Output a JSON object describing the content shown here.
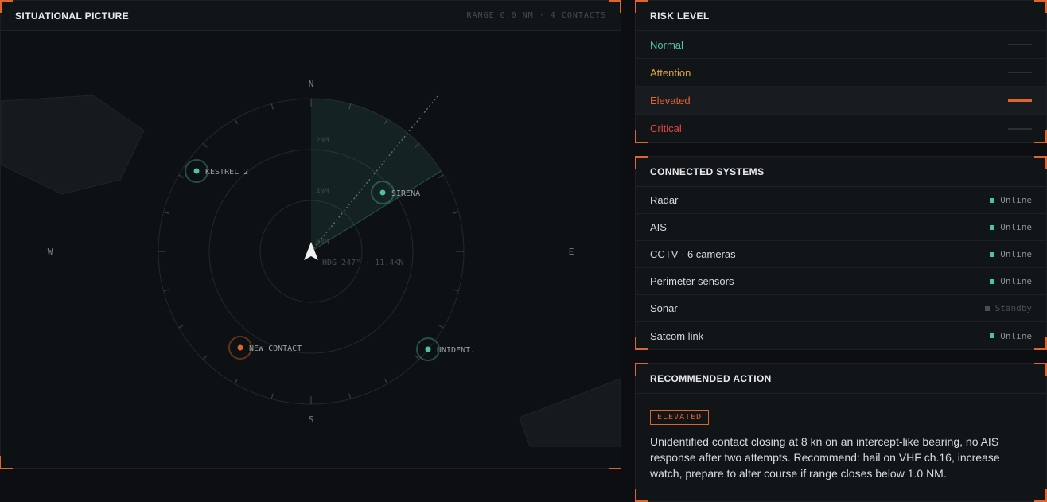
{
  "situational": {
    "title": "SITUATIONAL PICTURE",
    "meta": "RANGE 6.0 NM · 4 CONTACTS",
    "compass": {
      "n": "N",
      "s": "S",
      "e": "E",
      "w": "W"
    },
    "rings": [
      "2NM",
      "4NM",
      "6NM"
    ],
    "heading": "HDG 247° · 11.4KN",
    "contacts": [
      {
        "label": "KESTREL 2",
        "color": "#4fc3a1"
      },
      {
        "label": "SIRENA",
        "color": "#4fc3a1"
      },
      {
        "label": "NEW CONTACT",
        "color": "#e0652d"
      },
      {
        "label": "UNIDENT.",
        "color": "#4fc3a1"
      }
    ]
  },
  "risk": {
    "title": "RISK LEVEL",
    "levels": [
      {
        "label": "Normal",
        "color": "#4fc3a1",
        "active": false
      },
      {
        "label": "Attention",
        "color": "#d9a441",
        "active": false
      },
      {
        "label": "Elevated",
        "color": "#e0652d",
        "active": true
      },
      {
        "label": "Critical",
        "color": "#e0483f",
        "active": false
      }
    ]
  },
  "systems": {
    "title": "CONNECTED SYSTEMS",
    "items": [
      {
        "name": "Radar",
        "status": "Online"
      },
      {
        "name": "AIS",
        "status": "Online"
      },
      {
        "name": "CCTV · 6 cameras",
        "status": "Online"
      },
      {
        "name": "Perimeter sensors",
        "status": "Online"
      },
      {
        "name": "Sonar",
        "status": "Standby"
      },
      {
        "name": "Satcom link",
        "status": "Online"
      }
    ]
  },
  "action": {
    "title": "RECOMMENDED ACTION",
    "badge": "ELEVATED",
    "text": "Unidentified contact closing at 8 kn on an intercept-like bearing, no AIS response after two attempts. Recommend: hail on VHF ch.16, increase watch, prepare to alter course if range closes below 1.0 NM."
  },
  "colors": {
    "accent": "#e0652d",
    "online": "#4fc3a1",
    "standby": "#4a4f55"
  }
}
